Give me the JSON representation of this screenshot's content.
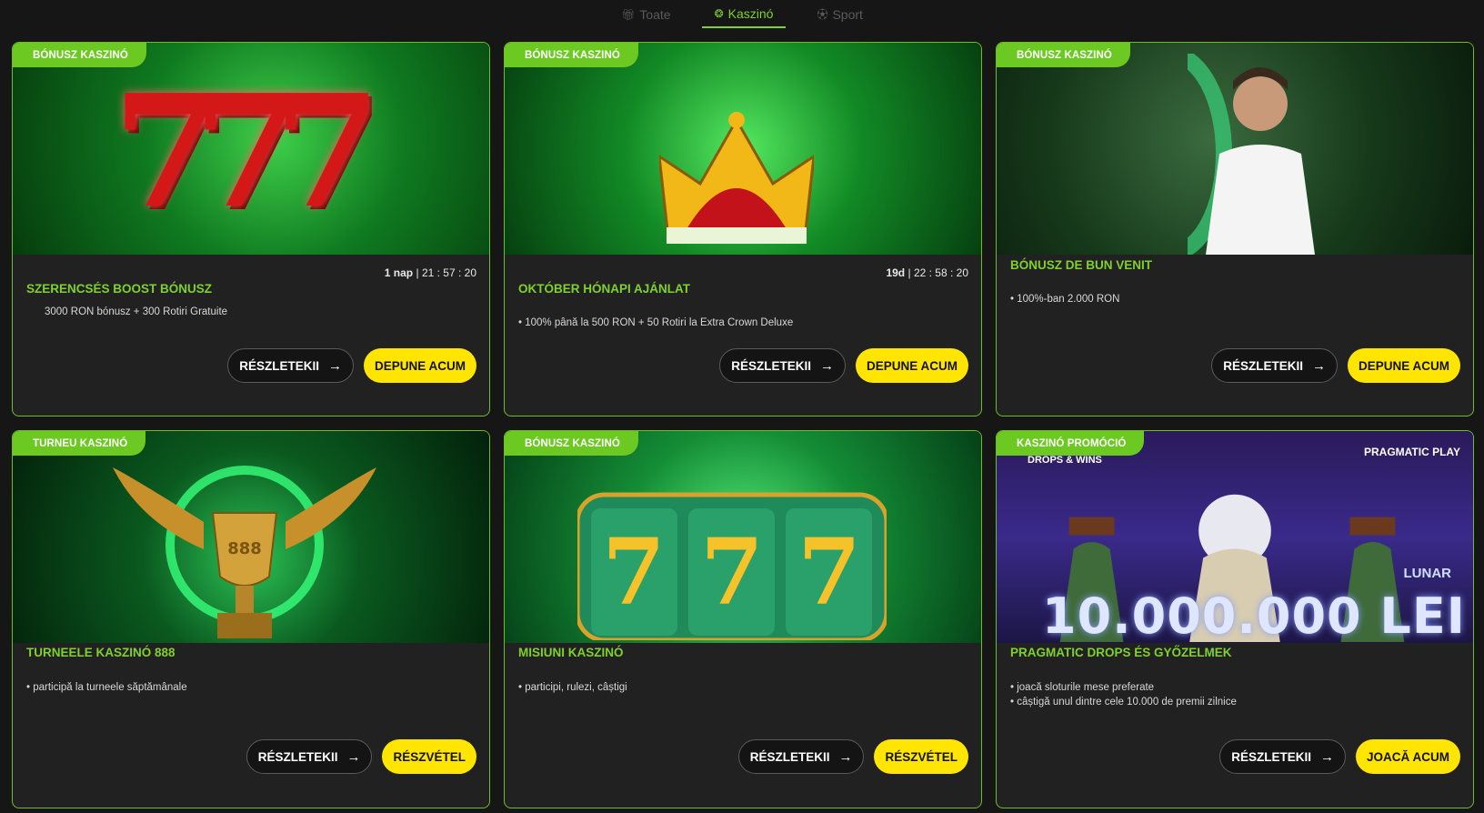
{
  "tabs": [
    {
      "label": "Toate",
      "icon": "gift-icon",
      "active": false
    },
    {
      "label": "Kaszinó",
      "icon": "chip-icon",
      "active": true
    },
    {
      "label": "Sport",
      "icon": "soccer-ball-icon",
      "active": false
    }
  ],
  "colors": {
    "accent": "#7fd12b",
    "badge": "#6cc922",
    "button_primary": "#ffe500",
    "card_bg": "#212121",
    "page_bg": "#161616"
  },
  "cards": [
    {
      "badge": "BÓNUSZ KASZINÓ",
      "timer": {
        "days": "1 nap",
        "sep": "|",
        "time": "21 : 57 : 20"
      },
      "title": "SZERENCSÉS BOOST BÓNUSZ",
      "desc": [
        "3000 RON bónusz + 300 Rotiri Gratuite"
      ],
      "details_label": "RÉSZLETEKII",
      "action_label": "DEPUNE ACUM",
      "art_text": "777"
    },
    {
      "badge": "BÓNUSZ KASZINÓ",
      "timer": {
        "days": "19d",
        "sep": "|",
        "time": "22 : 58 : 20"
      },
      "title": "OKTÓBER HÓNAPI AJÁNLAT",
      "desc": [
        "• 100% până la 500 RON + 50 Rotiri la Extra Crown Deluxe"
      ],
      "details_label": "RÉSZLETEKII",
      "action_label": "DEPUNE ACUM"
    },
    {
      "badge": "BÓNUSZ KASZINÓ",
      "title": "BÓNUSZ DE BUN VENIT",
      "desc": [
        "• 100%-ban 2.000 RON"
      ],
      "details_label": "RÉSZLETEKII",
      "action_label": "DEPUNE ACUM"
    },
    {
      "badge": "TURNEU KASZINÓ",
      "title": "TURNEELE KASZINÓ 888",
      "desc": [
        "• participă la turneele săptămânale"
      ],
      "details_label": "RÉSZLETEKII",
      "action_label": "RÉSZVÉTEL",
      "art_text": "888"
    },
    {
      "badge": "BÓNUSZ KASZINÓ",
      "title": "MISIUNI KASZINÓ",
      "desc": [
        "• participi, rulezi, câștigi"
      ],
      "details_label": "RÉSZLETEKII",
      "action_label": "RÉSZVÉTEL"
    },
    {
      "badge": "KASZINÓ PROMÓCIÓ",
      "title": "PRAGMATIC DROPS ÉS GYŐZELMEK",
      "desc": [
        "• joacă sloturile mese preferate",
        "• câștigă unul dintre cele 10.000 de premii zilnice"
      ],
      "details_label": "RÉSZLETEKII",
      "action_label": "JOACĂ ACUM",
      "art_text": "10.000.000 LEI",
      "art_logo": "PRAGMATIC PLAY",
      "art_logo2": "DROPS & WINS",
      "art_logo3": "LUNAR"
    }
  ]
}
